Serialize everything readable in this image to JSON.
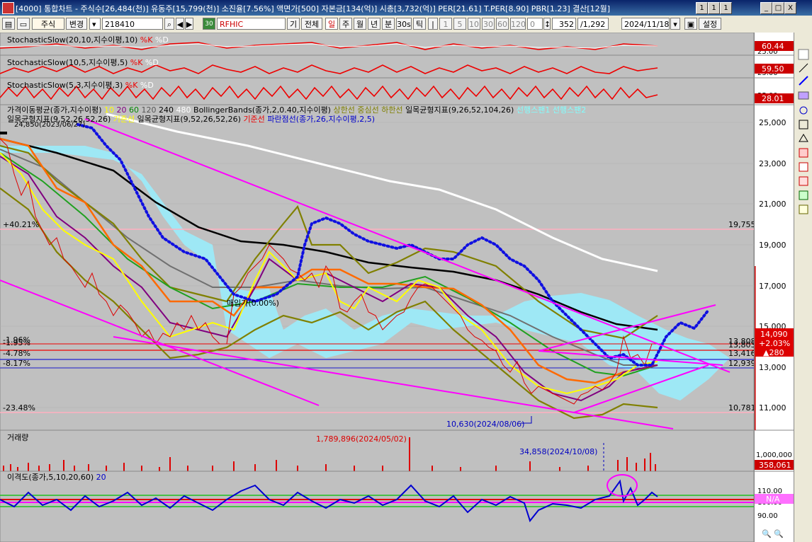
{
  "window": {
    "title": "[4000] 통합차트 - 주식수[26,484(천)] 유동주[15,799(천)] 소진율[7.56%] 액면가[500] 자본금[134(억)] 시총[3,732(억)] PER[21.61] T.PER[8.90] PBR[1.23] 결산[12월]",
    "min": "_",
    "max": "□",
    "close": "X",
    "extra": [
      "1",
      "1",
      "1"
    ]
  },
  "toolbar": {
    "market": "주식",
    "change": "변경",
    "code": "218410",
    "badge": "30",
    "name": "RFHIC",
    "periods": [
      "기",
      "전체",
      "일",
      "주",
      "월",
      "년",
      "분",
      "30s",
      "틱"
    ],
    "intervals": [
      "1",
      "5",
      "10",
      "30",
      "60",
      "120"
    ],
    "count": "0",
    "visible": "352",
    "total": "/1,292",
    "date": "2024/11/18",
    "settings": "설정"
  },
  "panels": {
    "stoch1": {
      "name": "StochasticSlow(20,10,지수이평,10)",
      "k": "%K",
      "d": "%D",
      "value": "60.44",
      "tick": "25.00"
    },
    "stoch2": {
      "name": "StochasticSlow(10,5,지수이평,5)",
      "k": "%K",
      "d": "%D",
      "value": "59.50",
      "tick": "25.00"
    },
    "stoch3": {
      "name": "StochasticSlow(5,3,지수이평,3)",
      "k": "%K",
      "d": "%D",
      "value": "28.01",
      "tick": "25.00"
    },
    "main": {
      "legend1": "가격이동평균(종가,지수이평)",
      "ma": [
        "10",
        "20",
        "60",
        "120",
        "240",
        "480"
      ],
      "bb": "BollingerBands(종가,2,0.40,지수이평)",
      "bb_lines": "상한선 중심선 하한선",
      "ich1": "일목균형지표(9,26,52,104,26)",
      "ich1_lines": "선행스팬1 선행스팬2",
      "legend2": "일목균형지표(9,52,26,52,26)",
      "leg2b": "기준선",
      "ich2": "일목균형지표(9,52,26,52,26)",
      "ich2_k": "기준선",
      "ich2_p": "파란점선(종가,26,지수이평,2,5)",
      "high_note": "24,850(2023/06/27)",
      "pct_left": [
        "+40.21%",
        "-1.96%",
        "-1.95%",
        "-4.78%",
        "-8.17%",
        "-23.48%"
      ],
      "level_right": [
        "19,755",
        "13,808",
        "13,803",
        "13,416",
        "12,939",
        "10,781"
      ],
      "low_note": "10,630(2024/08/06)",
      "mid_note": "매입가(0.00%)",
      "yticks": [
        "25,000",
        "23,000",
        "21,000",
        "19,000",
        "17,000",
        "15,000",
        "13,000",
        "11,000"
      ],
      "price": "14,090",
      "change": "+2.03%",
      "diff": "▲280"
    },
    "volume": {
      "name": "거래량",
      "peak": "1,789,896(2024/05/02)",
      "mark": "34,858(2024/10/08)",
      "tick": "1,000,000",
      "value": "358,061"
    },
    "disparity": {
      "name": "이격도(종가,5,10,20,60)",
      "period": "20",
      "ticks": [
        "110.00",
        "100.00",
        "90.00"
      ],
      "value": "N/A"
    }
  }
}
